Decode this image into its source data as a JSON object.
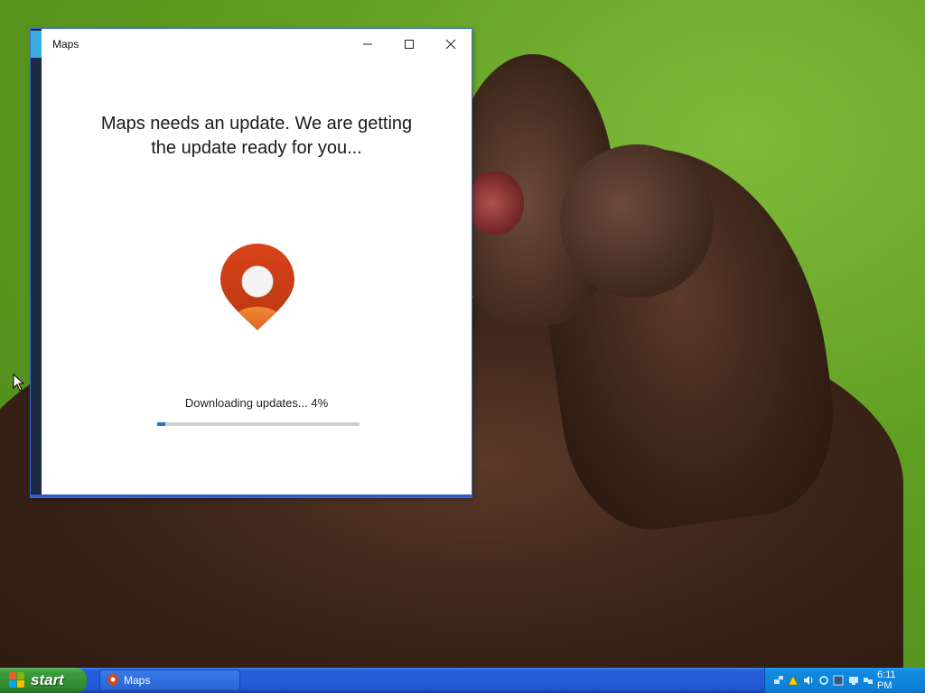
{
  "window": {
    "title": "Maps",
    "minimize_glyph": "—",
    "maximize_glyph": "☐",
    "close_glyph": "✕"
  },
  "content": {
    "headline_line1": "Maps needs an update. We are getting",
    "headline_line2": "the update ready for you...",
    "status_text": "Downloading updates... 4%",
    "progress_fraction": 0.04
  },
  "taskbar": {
    "start_label": "start",
    "task_item_label": "Maps",
    "clock": "6:11 PM"
  },
  "icons": {
    "app_logo": "maps-pin-icon",
    "tray": [
      "network-icon",
      "warning-icon",
      "volume-icon",
      "sync-icon",
      "security-icon",
      "display-icon",
      "network-connection-icon"
    ]
  },
  "colors": {
    "progress_fill": "#2f6fc6",
    "pin_primary": "#d6461b",
    "pin_secondary": "#f07a2a"
  }
}
